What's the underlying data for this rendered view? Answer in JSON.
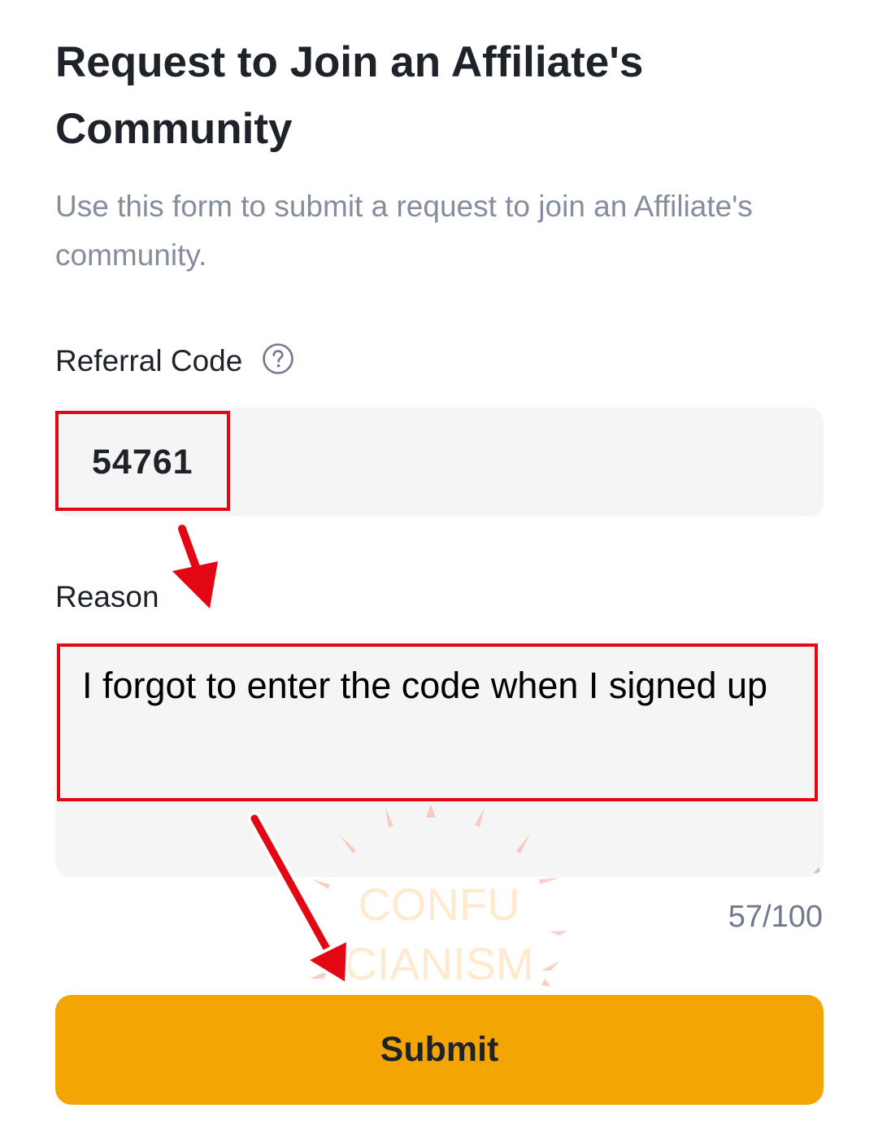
{
  "form": {
    "title": "Request to Join an Affiliate's Community",
    "subtitle": "Use this form to submit a request to join an Affiliate's community.",
    "referral_label": "Referral Code",
    "referral_value": "54761",
    "reason_label": "Reason",
    "reason_value": "I forgot to enter the code when I signed up",
    "char_counter": "57/100",
    "submit_label": "Submit"
  },
  "watermark": {
    "line1": "CONFU",
    "line2": "CIANISM"
  },
  "colors": {
    "accent": "#f3a603",
    "highlight": "#e30613",
    "input_bg": "#f5f5f5",
    "muted_text": "#848e9c"
  },
  "icons": {
    "help": "question-circle-icon",
    "arrow": "red-arrow-annotation"
  }
}
